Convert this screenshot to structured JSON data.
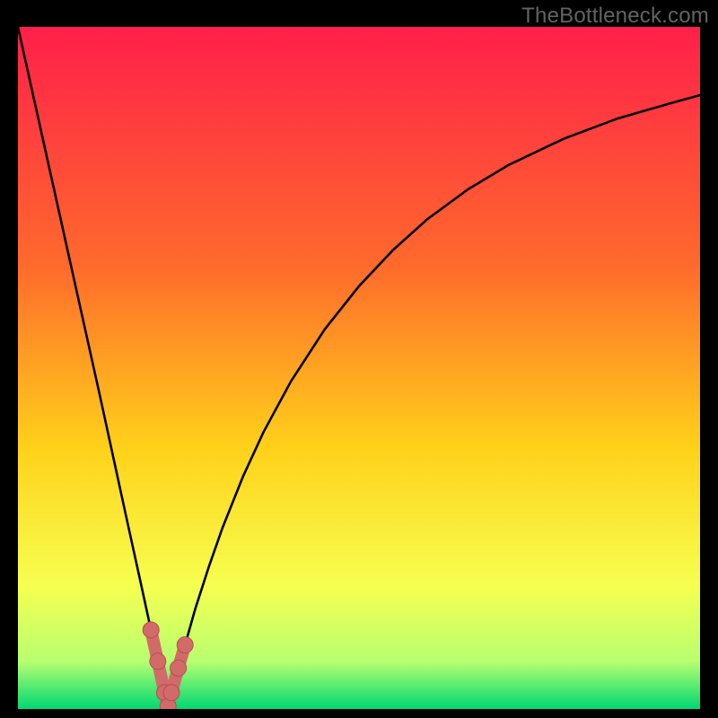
{
  "watermark": "TheBottleneck.com",
  "colors": {
    "gradient_top": "#ff1f4a",
    "gradient_mid1": "#ff6a2c",
    "gradient_mid2": "#ffd21a",
    "gradient_mid3": "#f6ff50",
    "gradient_mid4": "#b8ff70",
    "gradient_bottom": "#00d873",
    "curve": "#000000",
    "marker_fill": "#d36a6a",
    "marker_stroke": "#b24f4f"
  },
  "chart_data": {
    "type": "line",
    "title": "",
    "xlabel": "",
    "ylabel": "",
    "xlim": [
      0,
      100
    ],
    "ylim": [
      0,
      100
    ],
    "notch_x": 22,
    "series": [
      {
        "name": "bottleneck-curve",
        "x": [
          0,
          2,
          4,
          6,
          8,
          10,
          12,
          14,
          16,
          18,
          19.5,
          20.5,
          21.5,
          22,
          22.5,
          23.5,
          24.5,
          26,
          28,
          30,
          33,
          36,
          40,
          45,
          50,
          55,
          60,
          66,
          72,
          80,
          88,
          96,
          100
        ],
        "y": [
          100,
          91,
          82,
          73,
          64,
          55,
          46,
          36.8,
          27.6,
          18.5,
          11.6,
          7.0,
          2.4,
          0.4,
          2.4,
          6.0,
          9.4,
          14.7,
          20.9,
          26.6,
          34.1,
          40.6,
          48.0,
          55.7,
          62.0,
          67.3,
          71.8,
          76.2,
          79.8,
          83.6,
          86.6,
          88.9,
          90.0
        ]
      }
    ],
    "markers": {
      "name": "notch-markers",
      "x": [
        19.5,
        20.5,
        21.5,
        22,
        22.5,
        23.5,
        24.5
      ],
      "y": [
        11.6,
        7.0,
        2.4,
        0.4,
        2.4,
        6.0,
        9.4
      ]
    }
  }
}
